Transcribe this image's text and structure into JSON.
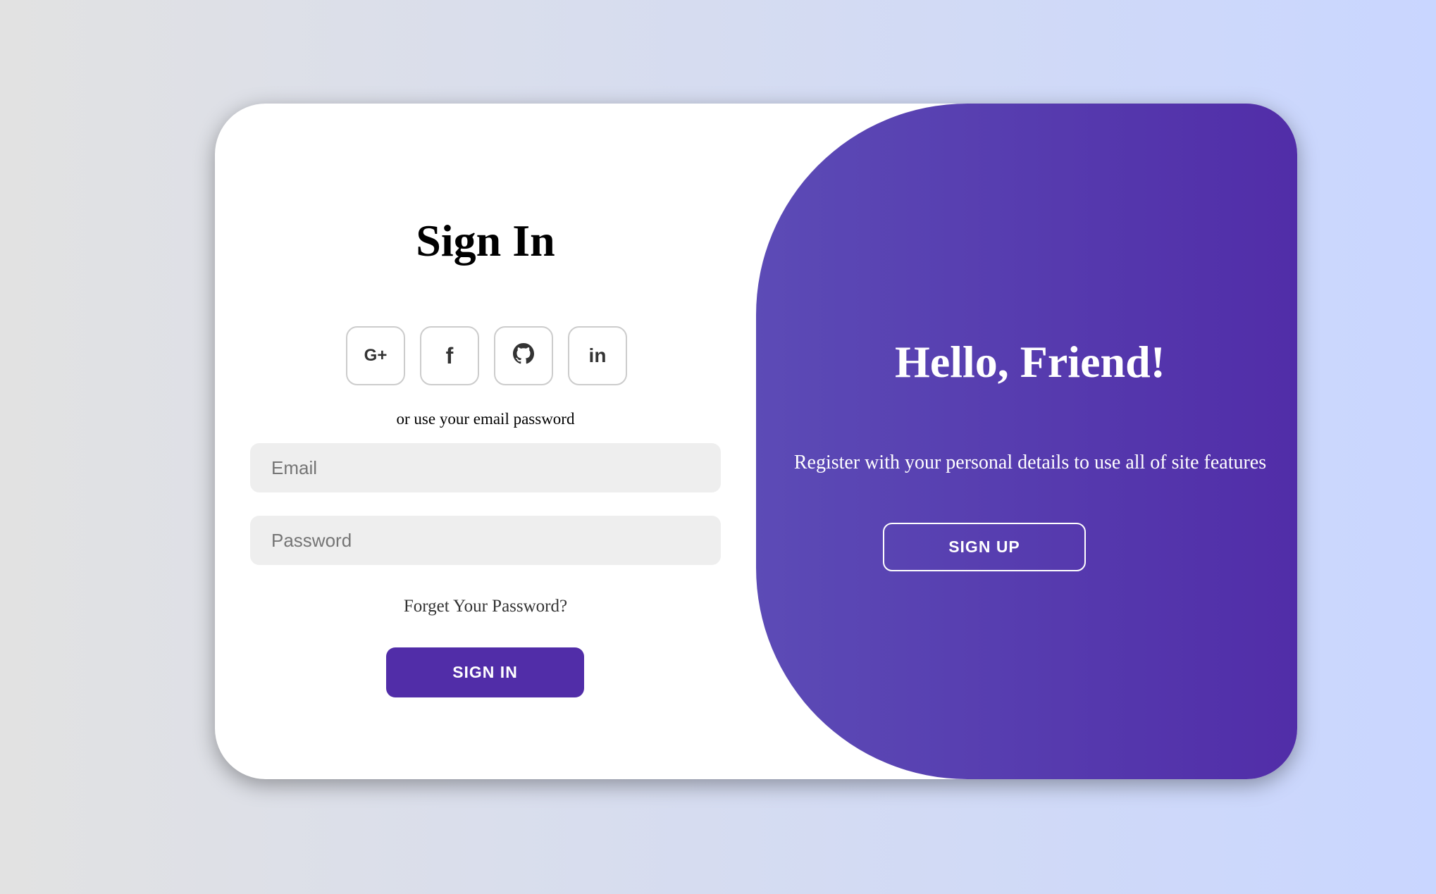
{
  "signin": {
    "title": "Sign In",
    "socials": [
      {
        "label": "G+",
        "icon": "google-plus-icon"
      },
      {
        "label": "f",
        "icon": "facebook-icon"
      },
      {
        "label": "",
        "icon": "github-icon"
      },
      {
        "label": "in",
        "icon": "linkedin-icon"
      }
    ],
    "divider_text": "or use your email password",
    "email_placeholder": "Email",
    "password_placeholder": "Password",
    "forgot_link": "Forget Your Password?",
    "submit_label": "SIGN IN"
  },
  "panel": {
    "title": "Hello, Friend!",
    "text": "Register with your personal details to use all of site features",
    "button_label": "SIGN UP"
  },
  "colors": {
    "accent": "#512da8",
    "panel_start": "#5c4bb6",
    "input_bg": "#eeeeee"
  }
}
